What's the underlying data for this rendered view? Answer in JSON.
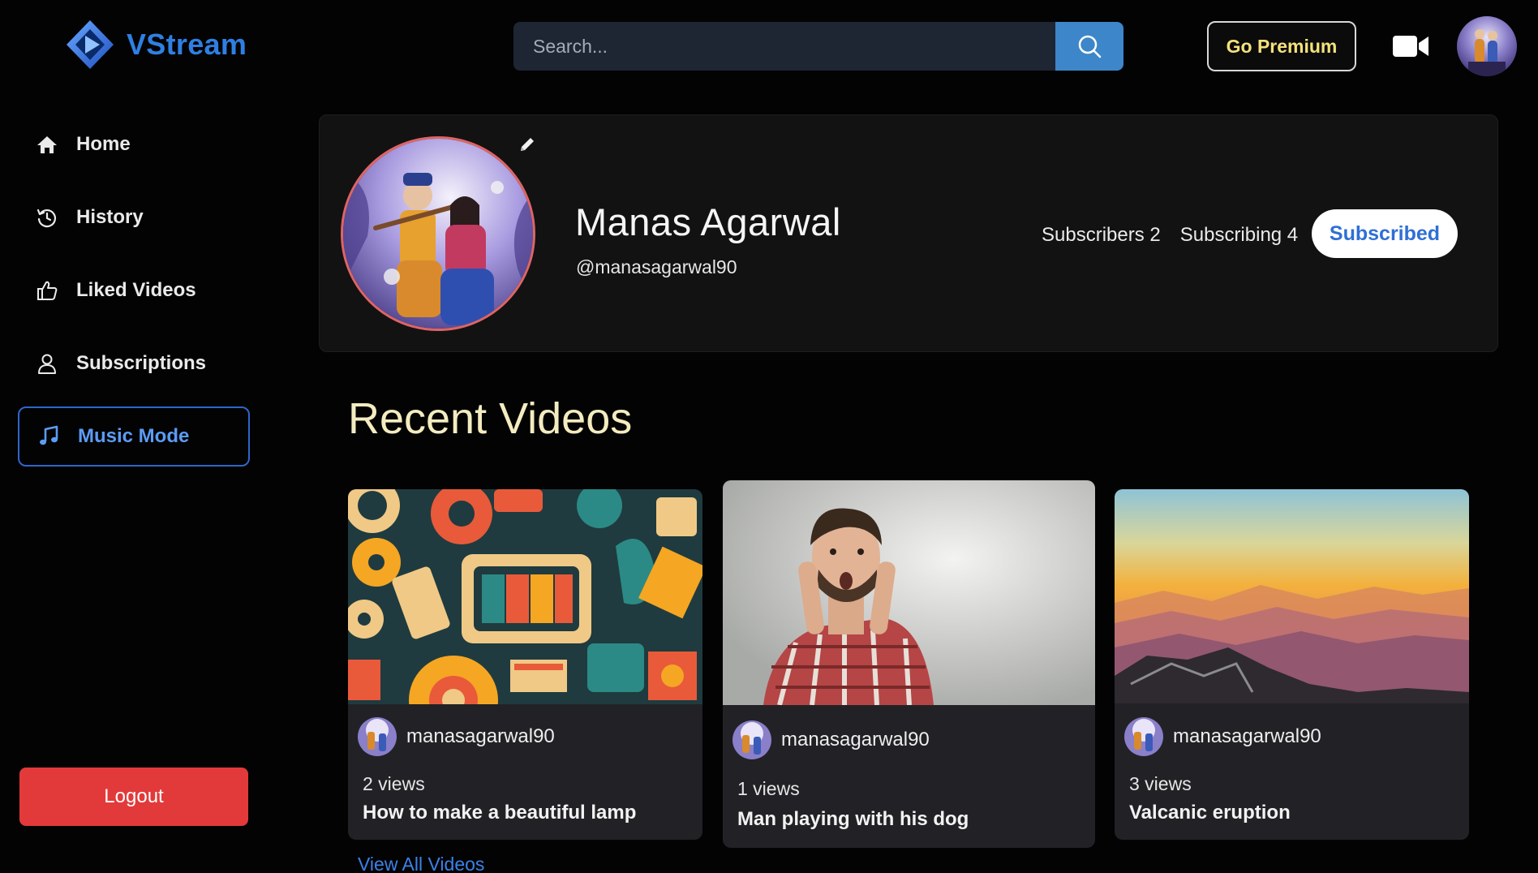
{
  "app": {
    "name": "VStream",
    "brand_color": "#2f7fe3",
    "accent_color": "#f4e27a"
  },
  "header": {
    "search_placeholder": "Search...",
    "search_icon": "search-icon",
    "premium_label": "Go Premium",
    "upload_icon": "video-camera-icon",
    "avatar_icon": "user-avatar"
  },
  "sidebar": {
    "items": [
      {
        "label": "Home",
        "icon": "home-icon"
      },
      {
        "label": "History",
        "icon": "history-icon"
      },
      {
        "label": "Liked Videos",
        "icon": "thumbs-up-icon"
      },
      {
        "label": "Subscriptions",
        "icon": "user-icon"
      },
      {
        "label": "Music Mode",
        "icon": "music-note-icon",
        "active": true
      }
    ],
    "logout_label": "Logout",
    "logout_color": "#e23a3a"
  },
  "profile": {
    "name": "Manas Agarwal",
    "handle": "@manasagarwal90",
    "subscribers": "Subscribers 2",
    "subscribing": "Subscribing 4",
    "subscribe_label": "Subscribed",
    "edit_icon": "pencil-icon"
  },
  "recent": {
    "title": "Recent Videos",
    "view_all": "View All Videos",
    "videos": [
      {
        "channel": "manasagarwal90",
        "views": "2 views",
        "title": "How to make a beautiful lamp"
      },
      {
        "channel": "manasagarwal90",
        "views": "1 views",
        "title": "Man playing with his dog"
      },
      {
        "channel": "manasagarwal90",
        "views": "3 views",
        "title": "Valcanic eruption"
      }
    ]
  }
}
